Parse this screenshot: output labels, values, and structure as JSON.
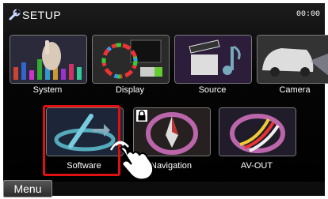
{
  "header": {
    "title": "SETUP",
    "clock": "00:00"
  },
  "tiles": [
    {
      "label": "System",
      "icon": "system-icon"
    },
    {
      "label": "Display",
      "icon": "display-icon"
    },
    {
      "label": "Source",
      "icon": "source-icon"
    },
    {
      "label": "Camera",
      "icon": "camera-icon"
    },
    {
      "label": "Software",
      "icon": "software-icon",
      "selected": true
    },
    {
      "label": "Navigation",
      "icon": "navigation-icon",
      "locked": true
    },
    {
      "label": "AV-OUT",
      "icon": "av-out-icon"
    }
  ],
  "footer": {
    "menu_label": "Menu"
  },
  "colors": {
    "selection": "#e01010",
    "background": "#000000",
    "text": "#ffffff"
  }
}
